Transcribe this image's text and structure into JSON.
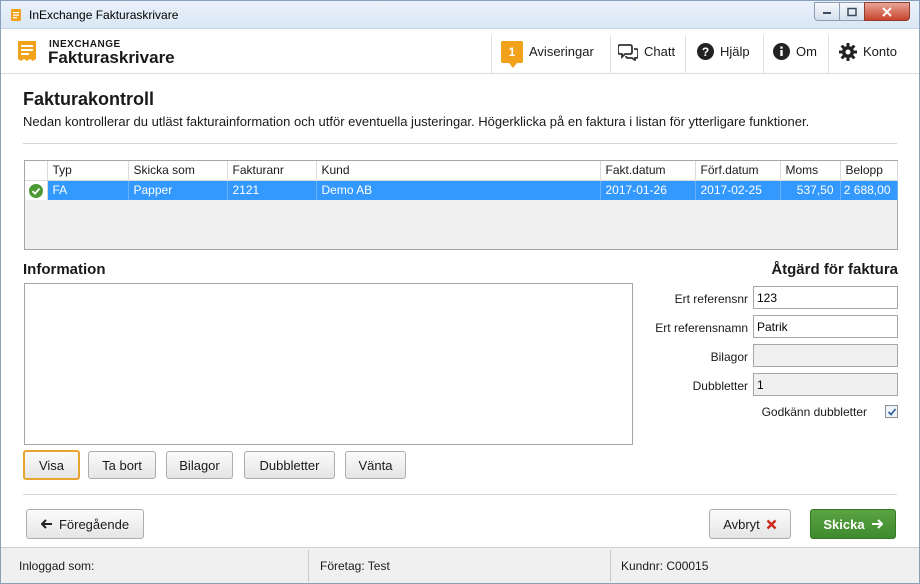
{
  "window": {
    "title": "InExchange Fakturaskrivare"
  },
  "brand": {
    "top": "INEXCHANGE",
    "name": "Fakturaskrivare"
  },
  "nav": {
    "notifications_count": "1",
    "notifications": "Aviseringar",
    "chat": "Chatt",
    "help": "Hjälp",
    "about": "Om",
    "account": "Konto"
  },
  "page": {
    "title": "Fakturakontroll",
    "description": "Nedan kontrollerar du utläst fakturainformation och utför eventuella justeringar. Högerklicka på en faktura i listan för ytterligare funktioner."
  },
  "grid": {
    "columns": [
      "Typ",
      "Skicka som",
      "Fakturanr",
      "Kund",
      "Fakt.datum",
      "Förf.datum",
      "Moms",
      "Belopp"
    ],
    "rows": [
      {
        "status": "ok",
        "typ": "FA",
        "skicka_som": "Papper",
        "fakturanr": "2121",
        "kund": "Demo AB",
        "fakt_datum": "2017-01-26",
        "forf_datum": "2017-02-25",
        "moms": "537,50",
        "belopp": "2 688,00"
      }
    ]
  },
  "information": {
    "title": "Information"
  },
  "action": {
    "title": "Åtgärd för faktura",
    "ref_nr_label": "Ert referensnr",
    "ref_nr_value": "123",
    "ref_name_label": "Ert referensnamn",
    "ref_name_value": "Patrik",
    "attachments_label": "Bilagor",
    "attachments_value": "",
    "duplicates_label": "Dubbletter",
    "duplicates_value": "1",
    "approve_duplicates_label": "Godkänn dubbletter",
    "approve_duplicates_checked": true
  },
  "buttons": {
    "show": "Visa",
    "remove": "Ta bort",
    "attachments": "Bilagor",
    "duplicates": "Dubbletter",
    "wait": "Vänta",
    "previous": "Föregående",
    "cancel": "Avbryt",
    "send": "Skicka"
  },
  "status": {
    "logged_in": "Inloggad som:",
    "company": "Företag: Test",
    "customer_nr": "Kundnr: C00015"
  },
  "colors": {
    "selection": "#3399ff",
    "accent_orange": "#f2a21a",
    "send_green": "#4a9a35",
    "cancel_red": "#cc2a1a"
  }
}
